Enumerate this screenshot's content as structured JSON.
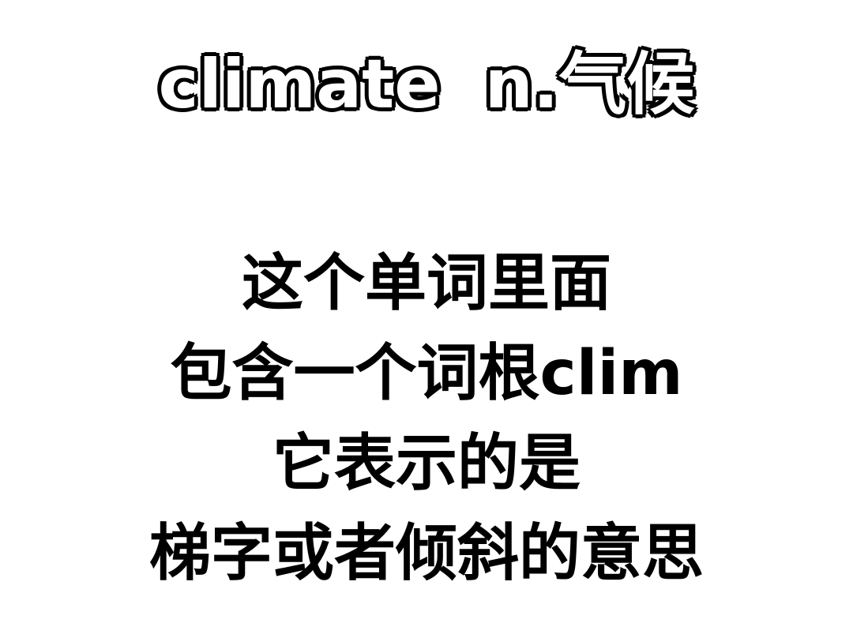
{
  "title": {
    "word": "climate",
    "definition": "n.气候"
  },
  "lines": [
    "这个单词里面",
    "包含一个词根clim",
    "它表示的是",
    "梯字或者倾斜的意思"
  ]
}
